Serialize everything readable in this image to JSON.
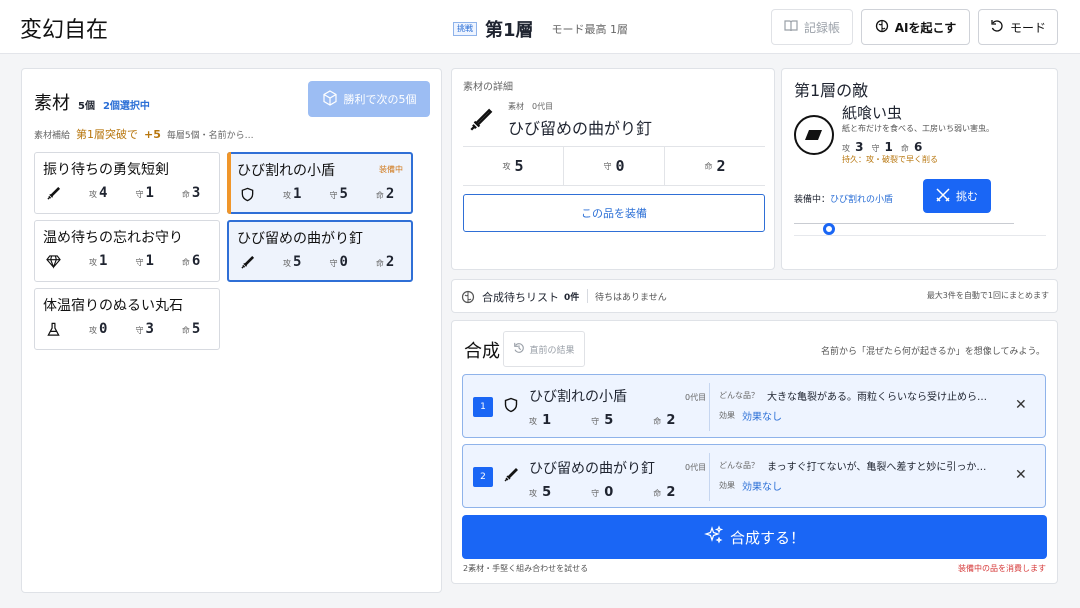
{
  "header": {
    "app_title": "変幻自在",
    "challenge_badge": "挑戦",
    "floor": "第1層",
    "mode_best": "モード最高 1層",
    "buttons": {
      "log": "記録帳",
      "ai": "AIを起こす",
      "mode": "モード"
    }
  },
  "materials": {
    "title": "素材",
    "count": "5個",
    "selected": "2個選択中",
    "next_button": "勝利で次の5個",
    "supply_label": "素材補給",
    "supply_cond": "第1層突破で",
    "supply_amount": "+5",
    "supply_note": "毎層5個・名前から…",
    "stat_keys": {
      "atk": "攻",
      "def": "守",
      "hp": "命"
    },
    "equipped_tag": "装備中",
    "cards": [
      {
        "name": "振り待ちの勇気短剣",
        "icon": "sword-icon",
        "atk": "4",
        "def": "1",
        "hp": "3",
        "selected": false,
        "equipped": false
      },
      {
        "name": "ひび割れの小盾",
        "icon": "shield-icon",
        "atk": "1",
        "def": "5",
        "hp": "2",
        "selected": true,
        "equipped": true
      },
      {
        "name": "温め待ちの忘れお守り",
        "icon": "gem-icon",
        "atk": "1",
        "def": "1",
        "hp": "6",
        "selected": false,
        "equipped": false
      },
      {
        "name": "ひび留めの曲がり釘",
        "icon": "nail-icon",
        "atk": "5",
        "def": "0",
        "hp": "2",
        "selected": true,
        "equipped": false
      },
      {
        "name": "体温宿りのぬるい丸石",
        "icon": "flask-icon",
        "atk": "0",
        "def": "3",
        "hp": "5",
        "selected": false,
        "equipped": false
      }
    ]
  },
  "detail": {
    "heading": "素材の詳細",
    "sub_label": "素材",
    "generation": "0代目",
    "name": "ひび留めの曲がり釘",
    "atk": "5",
    "def": "0",
    "hp": "2",
    "equip_button": "この品を装備"
  },
  "enemy": {
    "title": "第1層の敵",
    "name": "紙喰い虫",
    "desc": "紙と布だけを食べる、工房いち弱い害虫。",
    "atk": "3",
    "def": "1",
    "hp": "6",
    "note": "持久：攻・破裂で早く削る",
    "equipped_label": "装備中：",
    "equipped_item": "ひび割れの小盾",
    "challenge_button": "挑む",
    "slider_value": 0
  },
  "queue": {
    "label": "合成待ちリスト",
    "count": "0件",
    "empty": "待ちはありません",
    "note": "最大3件を自動で1回にまとめます"
  },
  "synth": {
    "title": "合成",
    "prev_button": "直前の結果",
    "hint": "名前から「混ぜたら何が起きるか」を想像してみよう。",
    "what_label": "どんな品？",
    "effect_label": "効果",
    "effect_none": "効果なし",
    "rows": [
      {
        "num": "1",
        "name": "ひび割れの小盾",
        "gen": "0代目",
        "atk": "1",
        "def": "5",
        "hp": "2",
        "desc": "大きな亀裂がある。雨粒くらいなら受け止めら…"
      },
      {
        "num": "2",
        "name": "ひび留めの曲がり釘",
        "gen": "0代目",
        "atk": "5",
        "def": "0",
        "hp": "2",
        "desc": "まっすぐ打てないが、亀裂へ差すと妙に引っか…"
      }
    ],
    "button": "合成する！",
    "footer_left": "2素材・手堅く組み合わせを試せる",
    "footer_right": "装備中の品を消費します"
  }
}
